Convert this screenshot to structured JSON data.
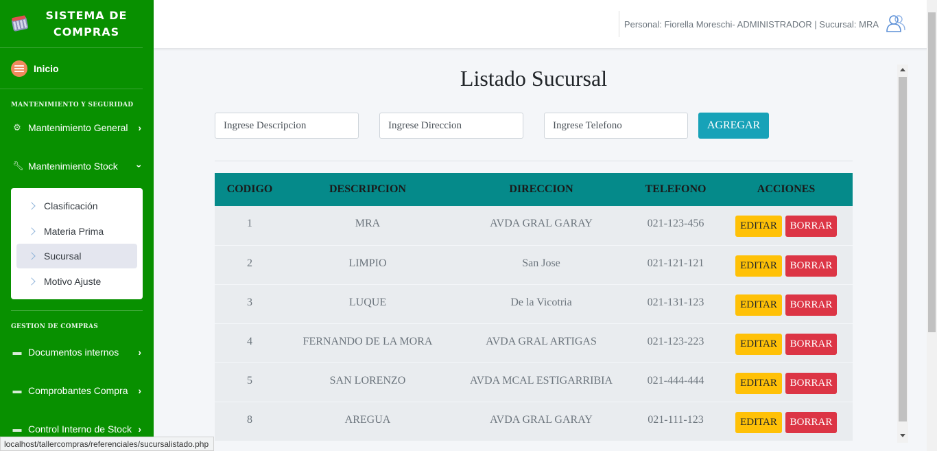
{
  "app": {
    "brand_line1": "SISTEMA DE",
    "brand_line2": "COMPRAS"
  },
  "sidebar": {
    "home_label": "Inicio",
    "section1": "MANTENIMIENTO Y SEGURIDAD",
    "items_top": [
      {
        "label": "Mantenimiento General",
        "icon": "gear-icon"
      },
      {
        "label": "Mantenimiento Stock",
        "icon": "wrench-icon"
      }
    ],
    "submenu": [
      "Clasificación",
      "Materia Prima",
      "Sucursal",
      "Motivo Ajuste"
    ],
    "active_submenu": "Sucursal",
    "section2": "GESTION DE COMPRAS",
    "items_bottom": [
      {
        "label": "Documentos internos",
        "icon": "archive-icon"
      },
      {
        "label": "Comprobantes Compra",
        "icon": "archive-icon"
      },
      {
        "label": "Control Interno de Stock",
        "icon": "archive-icon"
      }
    ]
  },
  "header": {
    "user_text": "Personal: Fiorella Moreschi- ADMINISTRADOR | Sucursal: MRA"
  },
  "main": {
    "title": "Listado Sucursal",
    "placeholders": {
      "descripcion": "Ingrese Descripcion",
      "direccion": "Ingrese Direccion",
      "telefono": "Ingrese Telefono"
    },
    "add_button": "AGREGAR",
    "table": {
      "headers": [
        "CODIGO",
        "DESCRIPCION",
        "DIRECCION",
        "TELEFONO",
        "ACCIONES"
      ],
      "rows": [
        {
          "codigo": "1",
          "descripcion": "MRA",
          "direccion": "AVDA GRAL GARAY",
          "telefono": "021-123-456"
        },
        {
          "codigo": "2",
          "descripcion": "LIMPIO",
          "direccion": "San Jose",
          "telefono": "021-121-121"
        },
        {
          "codigo": "3",
          "descripcion": "LUQUE",
          "direccion": "De la Vicotria",
          "telefono": "021-131-123"
        },
        {
          "codigo": "4",
          "descripcion": "FERNANDO DE LA MORA",
          "direccion": "AVDA GRAL ARTIGAS",
          "telefono": "021-123-223"
        },
        {
          "codigo": "5",
          "descripcion": "SAN LORENZO",
          "direccion": "AVDA MCAL ESTIGARRIBIA",
          "telefono": "021-444-444"
        },
        {
          "codigo": "8",
          "descripcion": "AREGUA",
          "direccion": "AVDA GRAL GARAY",
          "telefono": "021-111-123"
        }
      ],
      "edit_label": "EDITAR",
      "delete_label": "BORRAR"
    }
  },
  "status_bar": "localhost/tallercompras/referenciales/sucursalistado.php",
  "colors": {
    "sidebar": "#089000",
    "table_header": "#058a8a",
    "add": "#17a2b8",
    "edit": "#ffc107",
    "delete": "#dc3545"
  }
}
